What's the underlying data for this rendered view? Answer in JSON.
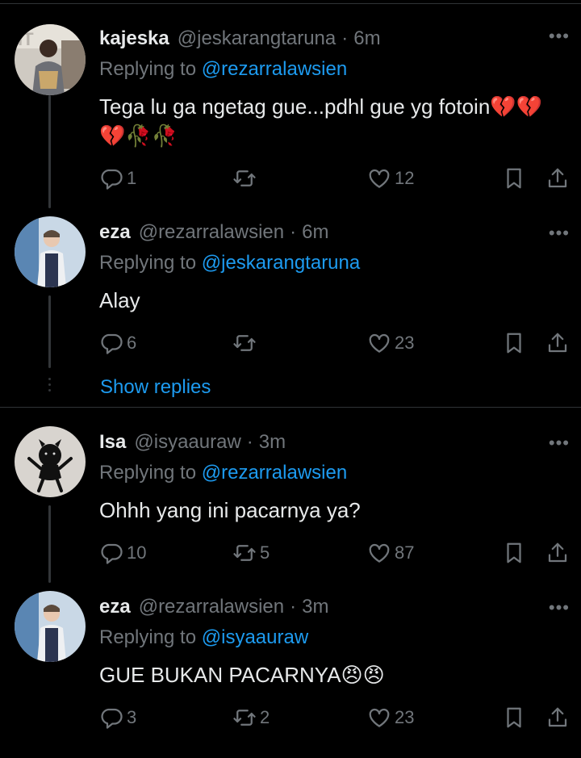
{
  "tweets": [
    {
      "name": "kajeska",
      "handle": "@jeskarangtaruna",
      "time": "6m",
      "replying_prefix": "Replying to ",
      "replying_to": "@rezarralawsien",
      "text": "Tega lu ga ngetag gue...pdhl gue yg fotoin💔💔💔🥀🥀",
      "replies": "1",
      "retweets": "",
      "likes": "12"
    },
    {
      "name": "eza",
      "handle": "@rezarralawsien",
      "time": "6m",
      "replying_prefix": "Replying to ",
      "replying_to": "@jeskarangtaruna",
      "text": "Alay",
      "replies": "6",
      "retweets": "",
      "likes": "23"
    },
    {
      "name": "Isa",
      "handle": "@isyaauraw",
      "time": "3m",
      "replying_prefix": "Replying to ",
      "replying_to": "@rezarralawsien",
      "text": "Ohhh yang ini pacarnya ya?",
      "replies": "10",
      "retweets": "5",
      "likes": "87"
    },
    {
      "name": "eza",
      "handle": "@rezarralawsien",
      "time": "3m",
      "replying_prefix": "Replying to ",
      "replying_to": "@isyaauraw",
      "text": "GUE BUKAN PACARNYA😠😠",
      "replies": "3",
      "retweets": "2",
      "likes": "23"
    }
  ],
  "show_replies": "Show replies",
  "separator": "·",
  "more_glyph": "•••",
  "colors": {
    "background": "#000000",
    "accent": "#1d9bf0",
    "muted": "#71767b",
    "text": "#e7e9ea"
  },
  "icons": [
    "reply-icon",
    "retweet-icon",
    "like-icon",
    "bookmark-icon",
    "share-icon",
    "more-icon"
  ]
}
